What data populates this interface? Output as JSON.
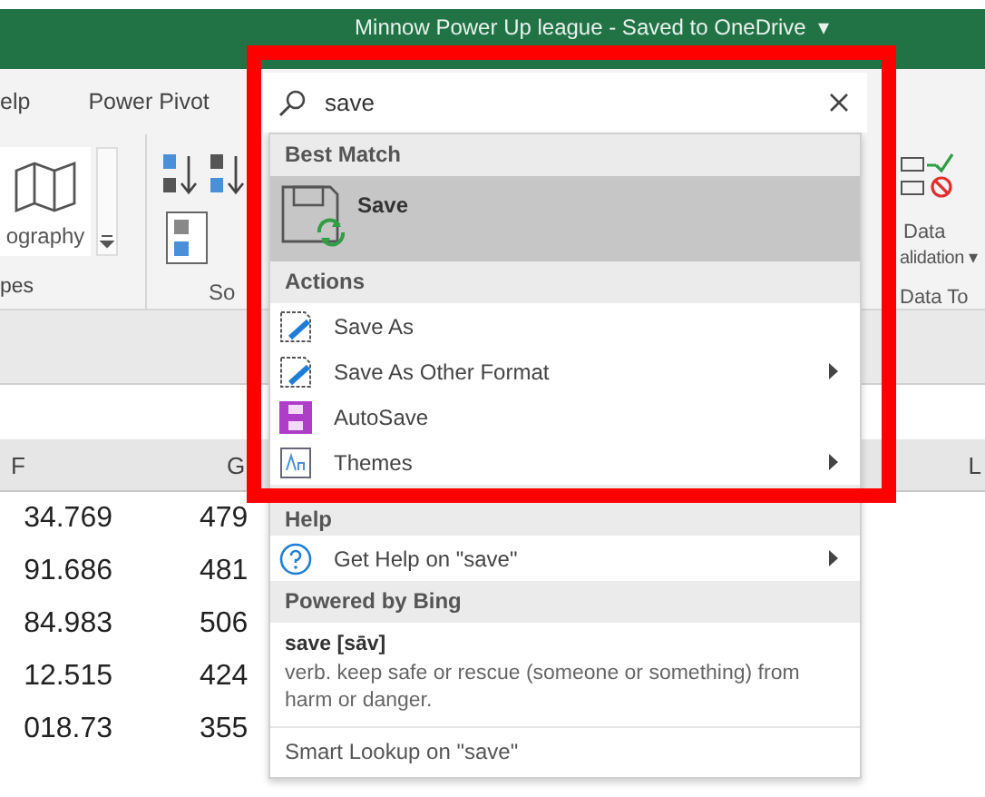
{
  "window": {
    "title": "Minnow Power Up league  -  Saved to OneDrive",
    "title_caret": "▾"
  },
  "ribbon_tabs": [
    {
      "label": "elp"
    },
    {
      "label": "Power Pivot"
    }
  ],
  "ribbon": {
    "geography_label": "ography",
    "types_group_label": "pes",
    "sort_label": "So",
    "data_validation_label": "Data",
    "data_validation_label_2": "alidation ▾",
    "data_tools_group_label": "Data To"
  },
  "sheet": {
    "columns": [
      {
        "label": "F"
      },
      {
        "label": "G"
      },
      {
        "label": "L"
      }
    ],
    "rows": [
      [
        "34.769",
        "479",
        ""
      ],
      [
        "91.686",
        "481",
        ""
      ],
      [
        "84.983",
        "506",
        ""
      ],
      [
        "12.515",
        "424",
        ""
      ],
      [
        "018.73",
        "355",
        ""
      ]
    ]
  },
  "search": {
    "value": "save"
  },
  "results": {
    "sections": [
      {
        "header": "Best Match",
        "items": [
          {
            "kind": "large",
            "label": "Save",
            "selected": true
          }
        ]
      },
      {
        "header": "Actions",
        "items": [
          {
            "kind": "save_as",
            "label": "Save As",
            "selected": false,
            "submenu": false
          },
          {
            "kind": "save_as",
            "label": "Save As Other Format",
            "selected": false,
            "submenu": true
          },
          {
            "kind": "autosave",
            "label": "AutoSave",
            "selected": false,
            "submenu": false
          },
          {
            "kind": "themes",
            "label": "Themes",
            "selected": false,
            "submenu": true
          }
        ]
      },
      {
        "header": "Help",
        "items": [
          {
            "kind": "help",
            "label": "Get Help on \"save\"",
            "selected": false,
            "submenu": true
          }
        ]
      },
      {
        "header": "Powered by Bing",
        "items": [
          {
            "kind": "definition",
            "term": "save [sāv]",
            "definition": "verb. keep safe or rescue (someone or something) from harm or danger."
          }
        ]
      }
    ],
    "footer": "Smart Lookup on \"save\""
  },
  "highlight": {
    "shown": true
  }
}
